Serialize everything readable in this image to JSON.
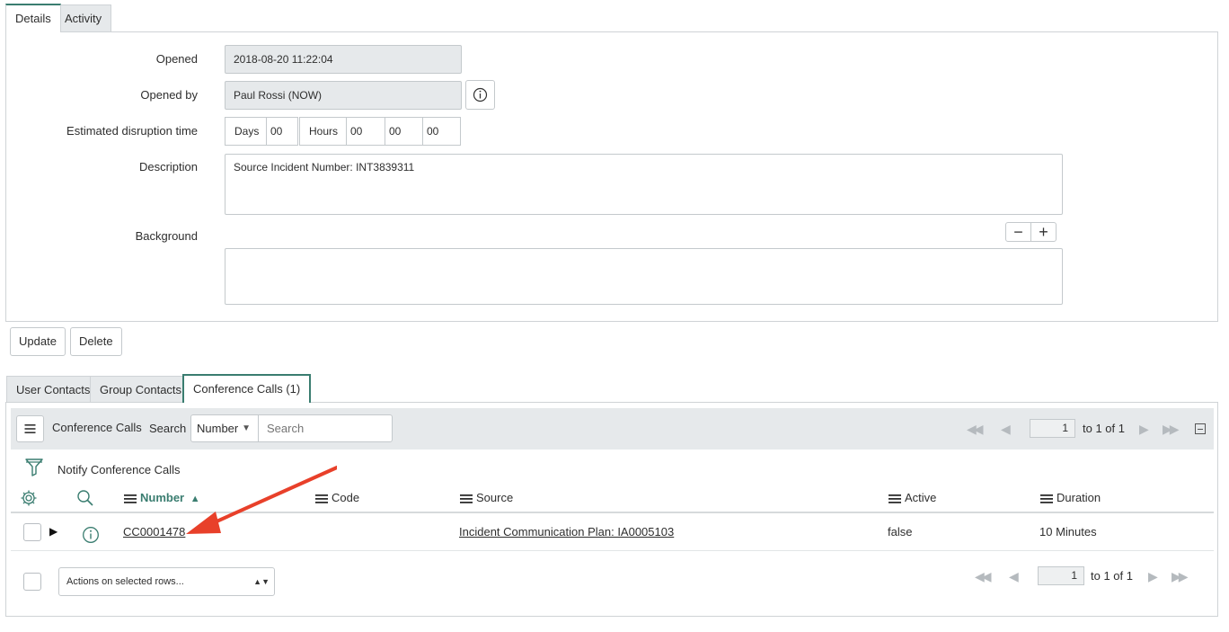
{
  "form_tabs": [
    "Details",
    "Activity"
  ],
  "form": {
    "opened_label": "Opened",
    "opened_value": "2018-08-20 11:22:04",
    "opened_by_label": "Opened by",
    "opened_by_value": "Paul Rossi (NOW)",
    "disruption_label": "Estimated disruption time",
    "days_label": "Days",
    "days_value": "00",
    "hours_label": "Hours",
    "hours_value": "00",
    "minutes_value": "00",
    "seconds_value": "00",
    "description_label": "Description",
    "description_value": "Source Incident Number: INT3839311",
    "background_label": "Background",
    "minus_symbol": "−",
    "plus_symbol": "+"
  },
  "actions": {
    "update_label": "Update",
    "delete_label": "Delete"
  },
  "related_tabs": [
    "User Contacts",
    "Group Contacts",
    "Conference Calls (1)"
  ],
  "list": {
    "title": "Conference Calls",
    "search_label": "Search",
    "search_field_select": "Number",
    "search_placeholder": "Search",
    "page_value": "1",
    "page_range": "to 1 of 1",
    "filter_text": "Notify Conference Calls",
    "columns": [
      "Number",
      "Code",
      "Source",
      "Active",
      "Duration"
    ],
    "sorted_column": "Number",
    "sort_direction": "ascending",
    "rows": [
      {
        "number": "CC0001478",
        "code": "",
        "source": "Incident Communication Plan: IA0005103",
        "active": "false",
        "duration": "10 Minutes"
      }
    ],
    "actions_select": "Actions on selected rows...",
    "bottom_page_value": "1",
    "bottom_page_range": "to 1 of 1"
  },
  "colors": {
    "accent": "#3a7d70",
    "annotation_arrow": "#e8402a",
    "readonly_bg": "#e6e9eb"
  }
}
